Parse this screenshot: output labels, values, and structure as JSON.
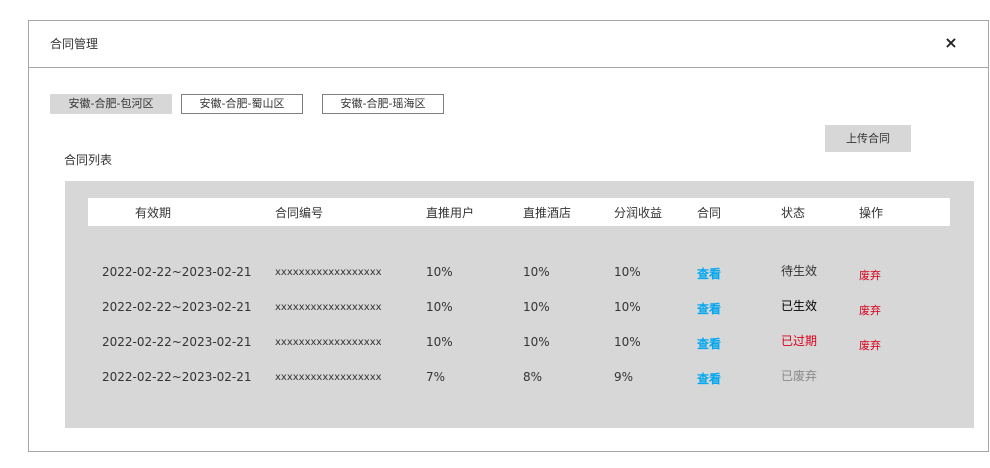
{
  "dialog": {
    "title": "合同管理",
    "close_symbol": "×"
  },
  "tabs": [
    {
      "label": "安徽-合肥-包河区",
      "active": true
    },
    {
      "label": "安徽-合肥-蜀山区",
      "active": false
    },
    {
      "label": "安徽-合肥-瑶海区",
      "active": false
    }
  ],
  "upload_button": "上传合同",
  "section_title": "合同列表",
  "table": {
    "headers": [
      "有效期",
      "合同编号",
      "直推用户",
      "直推酒店",
      "分润收益",
      "合同",
      "状态",
      "操作"
    ],
    "rows": [
      {
        "period": "2022-02-22~2023-02-21",
        "code": "xxxxxxxxxxxxxxxxxx",
        "users": "10%",
        "hotels": "10%",
        "profit": "10%",
        "contract": "查看",
        "status": "待生效",
        "status_color": "#333333",
        "action": "废弃"
      },
      {
        "period": "2022-02-22~2023-02-21",
        "code": "xxxxxxxxxxxxxxxxxx",
        "users": "10%",
        "hotels": "10%",
        "profit": "10%",
        "contract": "查看",
        "status": "已生效",
        "status_color": "#000000",
        "action": "废弃"
      },
      {
        "period": "2022-02-22~2023-02-21",
        "code": "xxxxxxxxxxxxxxxxxx",
        "users": "10%",
        "hotels": "10%",
        "profit": "10%",
        "contract": "查看",
        "status": "已过期",
        "status_color": "#d9001b",
        "action": "废弃"
      },
      {
        "period": "2022-02-22~2023-02-21",
        "code": "xxxxxxxxxxxxxxxxxx",
        "users": "7%",
        "hotels": "8%",
        "profit": "9%",
        "contract": "查看",
        "status": "已废弃",
        "status_color": "#888888",
        "action": ""
      }
    ]
  },
  "colors": {
    "link_blue": "#02a7f0",
    "danger_red": "#d9001b",
    "panel_gray": "#d7d7d7"
  }
}
